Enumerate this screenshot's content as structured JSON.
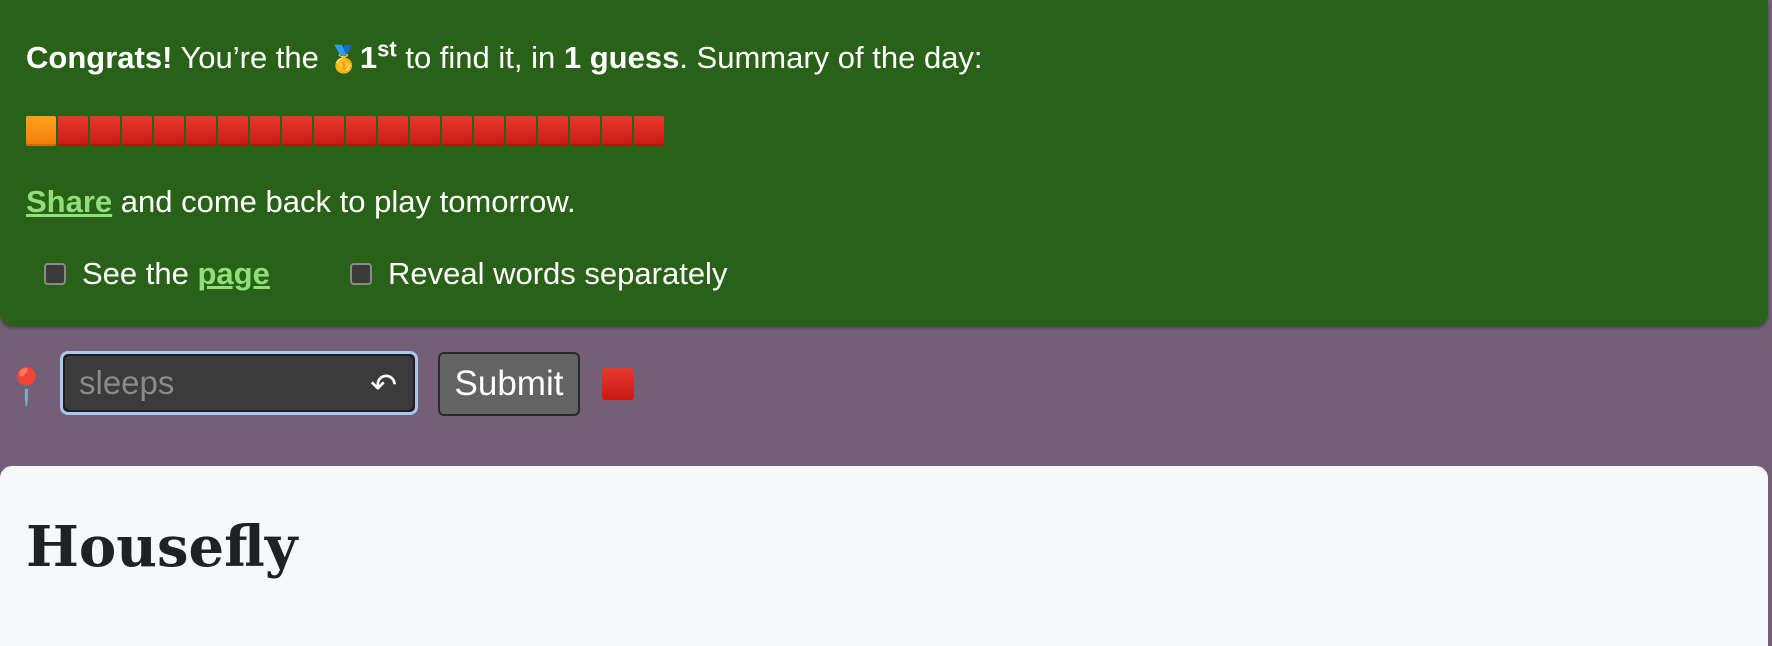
{
  "banner": {
    "congrats_bold": "Congrats!",
    "congrats_pre": " You’re the ",
    "medal": "🥇",
    "rank": "1",
    "rank_suffix": "st",
    "congrats_mid": " to find it, in ",
    "guesses": "1 guess",
    "congrats_post": ". Summary of the day:",
    "summary_squares": [
      "orange",
      "red",
      "red",
      "red",
      "red",
      "red",
      "red",
      "red",
      "red",
      "red",
      "red",
      "red",
      "red",
      "red",
      "red",
      "red",
      "red",
      "red",
      "red",
      "red"
    ],
    "share_link": "Share",
    "share_rest": " and come back to play tomorrow.",
    "option_page_pre": "See the ",
    "option_page_link": "page",
    "option_reveal": "Reveal words separately",
    "option_page_checked": false,
    "option_reveal_checked": false
  },
  "guess_bar": {
    "pin_icon": "📍",
    "placeholder": "sleeps",
    "undo_icon": "↶",
    "submit_label": "Submit",
    "status_color": "#d42a20"
  },
  "article": {
    "title": "Housefly"
  },
  "colors": {
    "banner_bg": "#2a6118",
    "page_bg": "#736078",
    "link": "#90e07a",
    "square_red": "#d42a20",
    "square_orange": "#f58b12"
  }
}
